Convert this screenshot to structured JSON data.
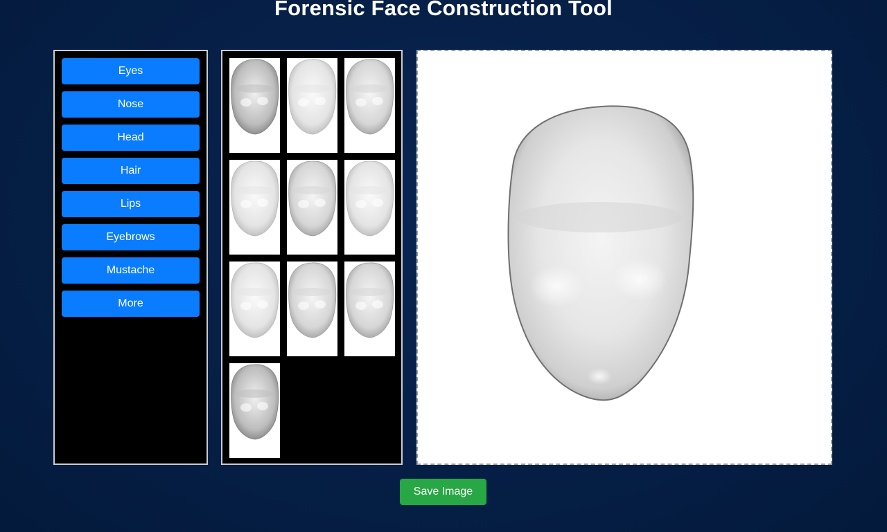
{
  "header": {
    "title": "Forensic Face Construction Tool"
  },
  "categories": [
    {
      "label": "Eyes"
    },
    {
      "label": "Nose"
    },
    {
      "label": "Head"
    },
    {
      "label": "Hair"
    },
    {
      "label": "Lips"
    },
    {
      "label": "Eyebrows"
    },
    {
      "label": "Mustache"
    },
    {
      "label": "More"
    }
  ],
  "thumbnails": [
    {
      "icon": "head-shape-thumbnail",
      "shade": "dark"
    },
    {
      "icon": "head-shape-thumbnail",
      "shade": "light"
    },
    {
      "icon": "head-shape-thumbnail",
      "shade": "medium"
    },
    {
      "icon": "head-shape-thumbnail",
      "shade": "light"
    },
    {
      "icon": "head-shape-thumbnail",
      "shade": "medium"
    },
    {
      "icon": "head-shape-thumbnail",
      "shade": "light"
    },
    {
      "icon": "head-shape-thumbnail",
      "shade": "light"
    },
    {
      "icon": "head-shape-thumbnail",
      "shade": "medium"
    },
    {
      "icon": "head-shape-thumbnail",
      "shade": "medium"
    },
    {
      "icon": "head-shape-thumbnail",
      "shade": "dark"
    }
  ],
  "canvas": {
    "content": "head-shape-composite"
  },
  "actions": {
    "save_label": "Save Image"
  },
  "colors": {
    "background": "#062048",
    "category_button": "#0a7cff",
    "save_button": "#28a745",
    "panel_border": "#c9ccd1"
  }
}
